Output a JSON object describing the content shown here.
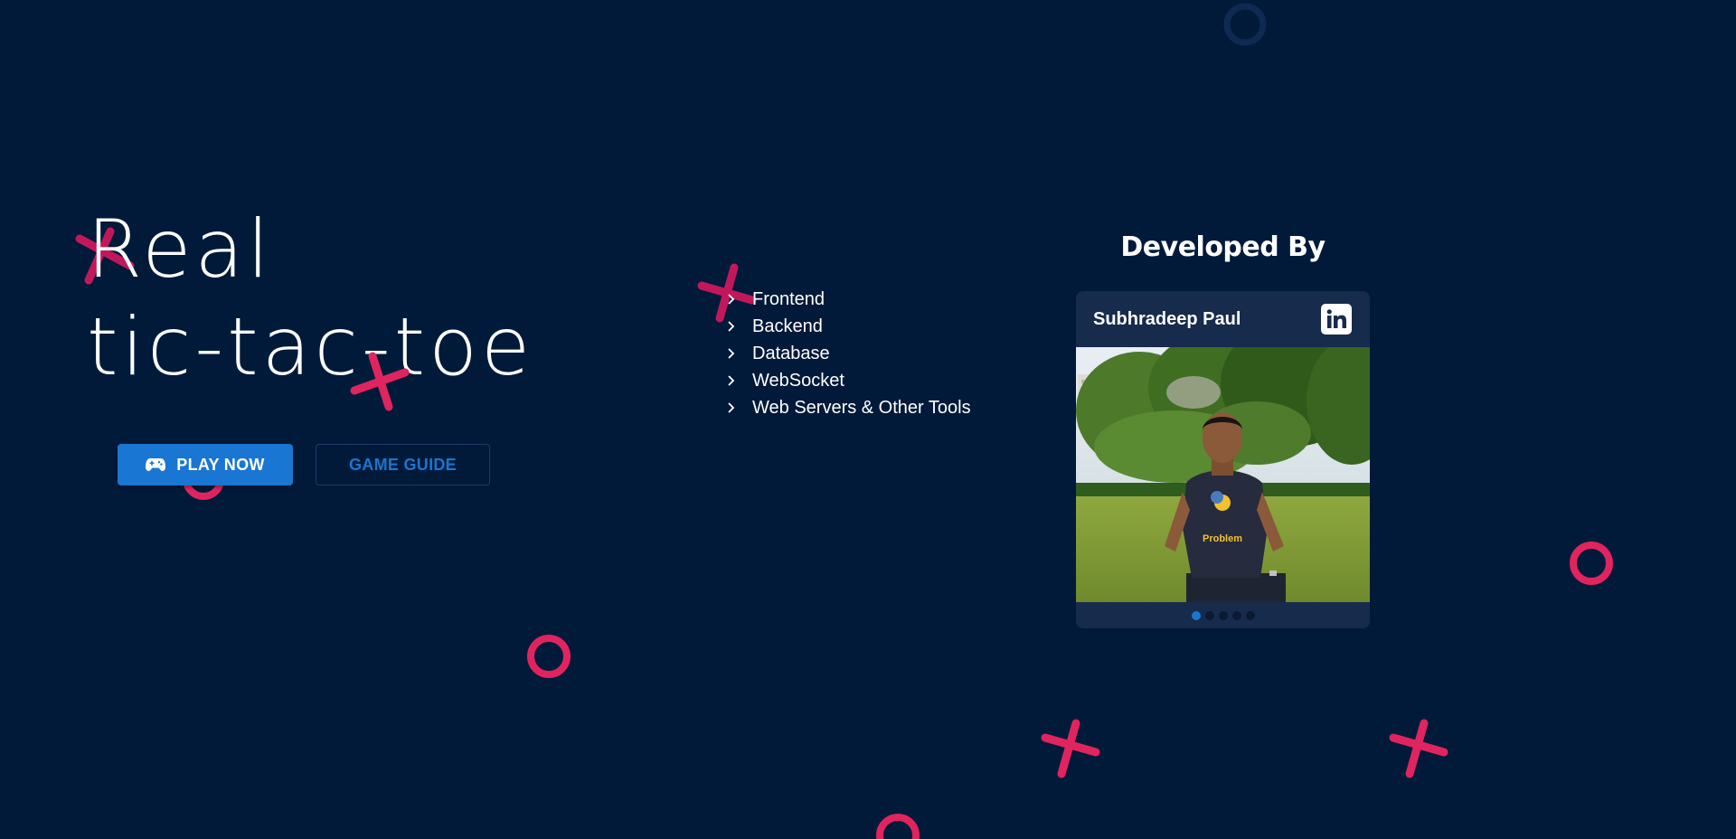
{
  "hero": {
    "title_line1": "Real",
    "title_line2": "tic-tac-toe"
  },
  "buttons": {
    "play_label": "PLAY NOW",
    "play_icon": "gamepad-icon",
    "guide_label": "GAME GUIDE"
  },
  "tech_list": [
    {
      "label": "Frontend"
    },
    {
      "label": "Backend"
    },
    {
      "label": "Database"
    },
    {
      "label": "WebSocket"
    },
    {
      "label": "Web Servers & Other Tools"
    }
  ],
  "developer": {
    "heading": "Developed By",
    "name": "Subhradeep Paul",
    "link_icon": "linkedin-icon",
    "photo_shirt_text": "Problem",
    "carousel": {
      "total": 5,
      "active": 1
    }
  },
  "colors": {
    "background": "#011a3a",
    "accent": "#1976d2",
    "shape": "#e0245e",
    "card": "#172b4d"
  }
}
